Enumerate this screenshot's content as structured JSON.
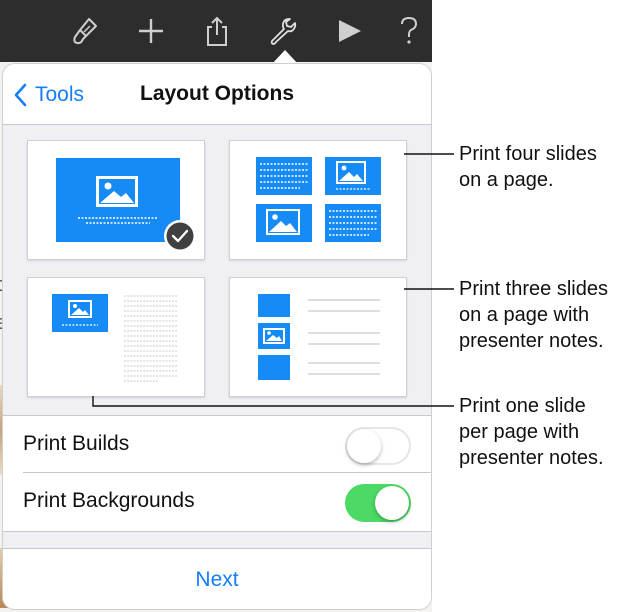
{
  "popover": {
    "back_label": "Tools",
    "title": "Layout Options"
  },
  "layouts": [
    {
      "id": "one-slide",
      "selected": true
    },
    {
      "id": "four-slides",
      "selected": false
    },
    {
      "id": "one-slide-notes",
      "selected": false
    },
    {
      "id": "three-slides-notes",
      "selected": false
    }
  ],
  "toggles": {
    "print_builds": {
      "label": "Print Builds",
      "on": false
    },
    "print_backgrounds": {
      "label": "Print Backgrounds",
      "on": true
    }
  },
  "next_label": "Next",
  "callouts": {
    "four_slides": "Print four slides\non a page.",
    "three_slides": "Print three slides\non a page with\npresenter notes.",
    "one_slide": "Print one slide\nper page with\npresenter notes."
  },
  "background_text": {
    "letter_c": "c",
    "letter_e": "e"
  },
  "colors": {
    "accent": "#147efb",
    "slide_blue": "#168af5",
    "switch_on": "#4cd964",
    "switch_off_border": "#e5e5ea",
    "toolbar": "#2d2d2d"
  },
  "icons": [
    "paintbrush-icon",
    "plus-icon",
    "share-icon",
    "wrench-icon",
    "play-icon",
    "help-icon",
    "chevron-left-icon",
    "checkmark-icon"
  ]
}
